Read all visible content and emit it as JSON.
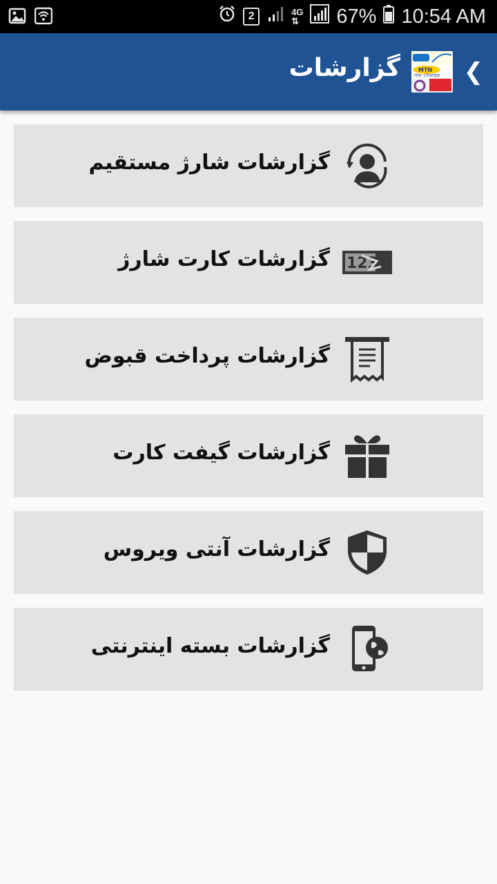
{
  "status_bar": {
    "network": "4G",
    "battery": "67%",
    "time": "10:54 AM",
    "notification_count": "2"
  },
  "app_bar": {
    "title": "گزارشات",
    "back_icon": "chevron-left-icon",
    "logo_icon": "operators-logo-icon",
    "color": "#1f5394"
  },
  "menu": {
    "items": [
      {
        "label": "گزارشات شارژ مستقیم",
        "icon": "support-agent-icon"
      },
      {
        "label": "گزارشات کارت شارژ",
        "icon": "scratch-card-icon"
      },
      {
        "label": "گزارشات پرداخت قبوض",
        "icon": "receipt-icon"
      },
      {
        "label": "گزارشات گیفت کارت",
        "icon": "gift-icon"
      },
      {
        "label": "گزارشات آنتی ویروس",
        "icon": "shield-icon"
      },
      {
        "label": "گزارشات بسته اینترنتی",
        "icon": "mobile-internet-icon"
      }
    ]
  }
}
